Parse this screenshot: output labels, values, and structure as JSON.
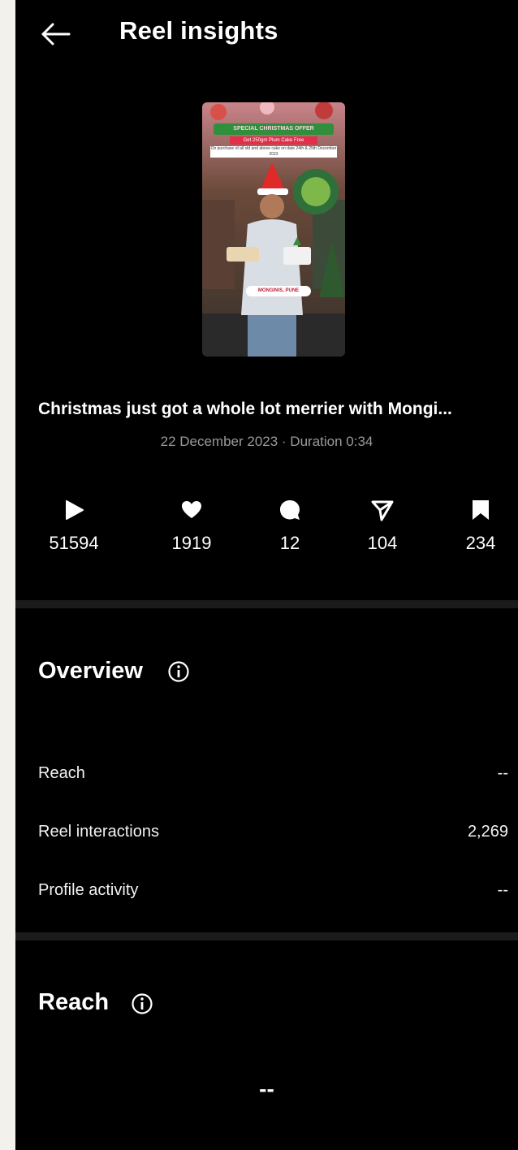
{
  "header": {
    "title": "Reel insights",
    "back_icon": "arrow-left-icon"
  },
  "thumbnail": {
    "banner_line1": "SPECIAL CHRISTMAS OFFER",
    "banner_line2": "Get 250gm Plum Cake Free",
    "banner_line3": "On purchase of all std and above cake on date 24th & 25th December 2023",
    "location_tag": "MONGINIS, PUNE"
  },
  "reel": {
    "caption": "Christmas just got a whole lot merrier with Mongi...",
    "meta": "22 December 2023 · Duration 0:34"
  },
  "stats": [
    {
      "icon": "play-icon",
      "value": "51594"
    },
    {
      "icon": "heart-icon",
      "value": "1919"
    },
    {
      "icon": "comment-icon",
      "value": "12"
    },
    {
      "icon": "share-icon",
      "value": "104"
    },
    {
      "icon": "bookmark-icon",
      "value": "234"
    }
  ],
  "overview": {
    "title": "Overview",
    "rows": [
      {
        "label": "Reach",
        "value": "--"
      },
      {
        "label": "Reel interactions",
        "value": "2,269"
      },
      {
        "label": "Profile activity",
        "value": "--"
      }
    ]
  },
  "reach": {
    "title": "Reach",
    "value": "--"
  },
  "colors": {
    "background": "#000000",
    "divider": "#1b1b1b",
    "muted_text": "#9a9a9a"
  }
}
